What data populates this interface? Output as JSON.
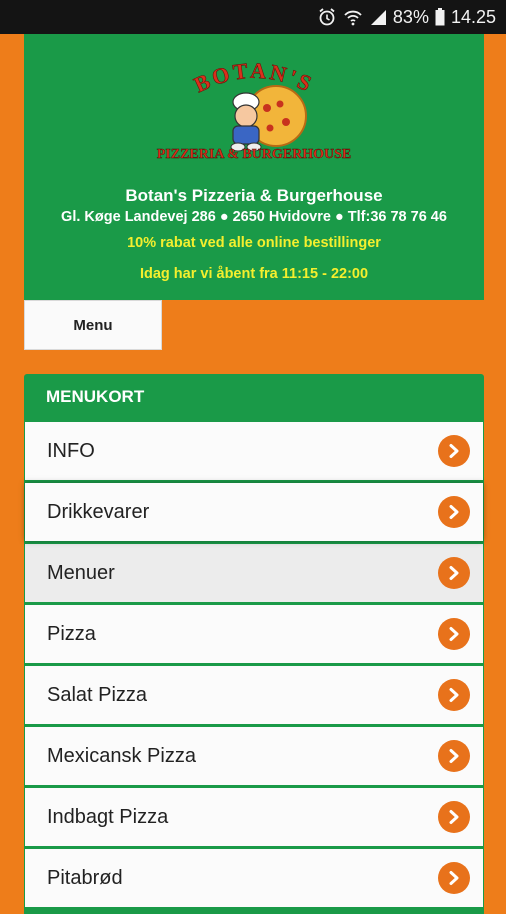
{
  "status_bar": {
    "battery": "83%",
    "time": "14.25"
  },
  "header": {
    "logo_top": "BOTAN'S",
    "logo_bottom": "PIZZERIA & BURGERHOUSE",
    "title": "Botan's Pizzeria & Burgerhouse",
    "address_street": "Gl. Køge Landevej 286",
    "address_city": "2650 Hvidovre",
    "phone": "Tlf:36 78 76 46",
    "promo": "10% rabat ved alle online bestillinger",
    "hours": "Idag har vi åbent fra 11:15 - 22:00"
  },
  "nav": {
    "menu_tab": "Menu"
  },
  "menukort": {
    "heading": "MENUKORT",
    "items": [
      {
        "label": "INFO"
      },
      {
        "label": "Drikkevarer"
      },
      {
        "label": "Menuer"
      },
      {
        "label": "Pizza"
      },
      {
        "label": "Salat Pizza"
      },
      {
        "label": "Mexicansk Pizza"
      },
      {
        "label": "Indbagt Pizza"
      },
      {
        "label": "Pitabrød"
      }
    ]
  },
  "colors": {
    "background": "#ee7d1a",
    "brand_green": "#1a9a48",
    "accent_yellow": "#f4ef2e",
    "chevron": "#e8721b"
  }
}
